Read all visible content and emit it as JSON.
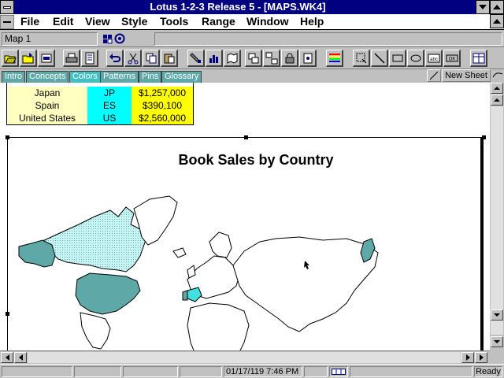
{
  "window": {
    "title": "Lotus 1-2-3 Release 5 - [MAPS.WK4]"
  },
  "menu": {
    "items": [
      "File",
      "Edit",
      "View",
      "Style",
      "Tools",
      "Range",
      "Window",
      "Help"
    ]
  },
  "address": {
    "selection": "Map 1"
  },
  "toolbar": {
    "icons": [
      "open-file-icon",
      "open-folder-icon",
      "save-icon",
      "print-icon",
      "print-preview-icon",
      "undo-icon",
      "cut-icon",
      "copy-icon",
      "paste-icon",
      "format-painter-icon",
      "chart-icon",
      "map-icon",
      "group-icon",
      "ungroup-icon",
      "lock-icon",
      "fasten-icon",
      "color-palette-icon",
      "select-icon",
      "line-icon",
      "rectangle-icon",
      "ellipse-icon",
      "text-block-icon",
      "button-icon",
      "arrange-icon"
    ]
  },
  "tabs": [
    "Intro",
    "Concepts",
    "Colors",
    "Patterns",
    "Pins",
    "Glossary"
  ],
  "new_sheet_label": "New Sheet",
  "table": {
    "rows": [
      {
        "country": "Japan",
        "code": "JP",
        "sales": "$1,257,000"
      },
      {
        "country": "Spain",
        "code": "ES",
        "sales": "$390,100"
      },
      {
        "country": "United States",
        "code": "US",
        "sales": "$2,560,000"
      }
    ],
    "colors": {
      "country": "#ffffc0",
      "code": "#00ffff",
      "sales": "#ffff00"
    }
  },
  "map": {
    "title": "Book Sales by Country",
    "colors": {
      "high": "#5fa8a8",
      "mid": "#40e0e0",
      "light": "#c0f0f0",
      "land": "#ffffff",
      "border": "#000000"
    }
  },
  "status": {
    "datetime": "01/17/119  7:46 PM",
    "mode": "Ready"
  }
}
